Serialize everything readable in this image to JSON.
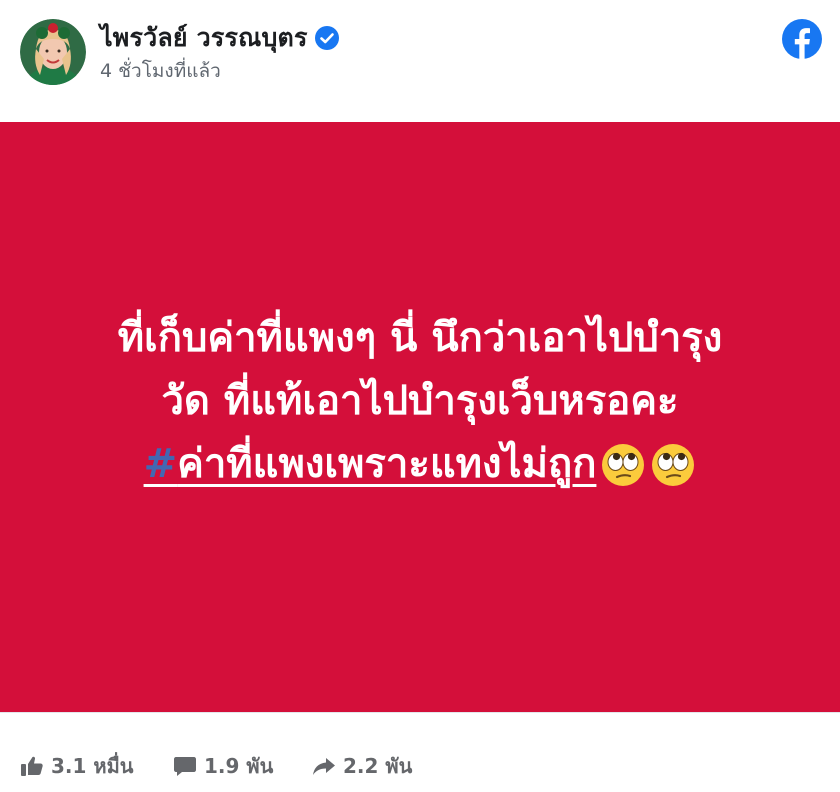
{
  "post": {
    "author": "ไพรวัลย์ วรรณบุตร",
    "verified": true,
    "timestamp": "4 ชั่วโมงที่แล้ว",
    "brand_color": "#1877f2",
    "image": {
      "background_color": "#d40f3a",
      "text_color": "#ffffff",
      "line1": "ที่เก็บค่าที่แพงๆ นี่ นึกว่าเอาไปบำรุง",
      "line2": "วัด ที่แท้เอาไปบำรุงเว็บหรอคะ",
      "hashtag_mark": "#",
      "hashtag_text": "ค่าที่แพงเพราะแทงไม่ถูก",
      "emojis": [
        "face-with-rolling-eyes",
        "face-with-rolling-eyes"
      ]
    }
  },
  "stats": {
    "likes": "3.1 หมื่น",
    "comments": "1.9 พัน",
    "shares": "2.2 พัน"
  }
}
